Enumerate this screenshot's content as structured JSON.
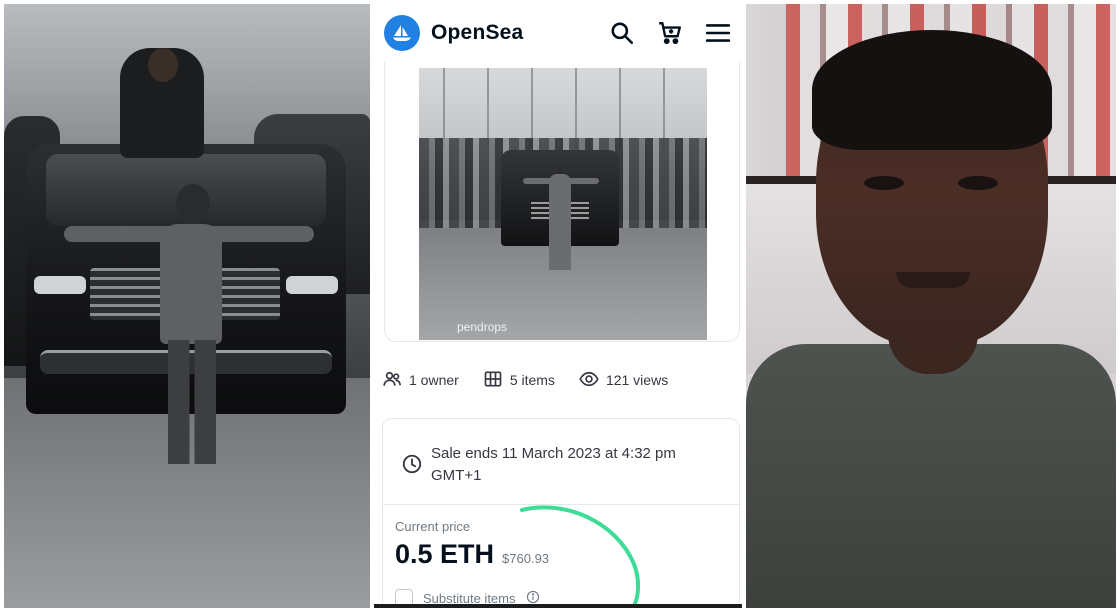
{
  "opensea": {
    "brand": "OpenSea",
    "nft_watermark": "pendrops",
    "stats": {
      "owners": "1 owner",
      "items": "5 items",
      "views": "121 views"
    },
    "sale": {
      "ends_text": "Sale ends 11 March 2023 at 4:32 pm GMT+1",
      "current_price_label": "Current price",
      "price_eth": "0.5 ETH",
      "price_usd": "$760.93",
      "substitute_label": "Substitute items"
    }
  },
  "icons": {
    "logo": "opensea-boat-icon",
    "search": "search-icon",
    "cart": "cart-icon",
    "menu": "hamburger-menu-icon",
    "owner": "users-icon",
    "items": "grid-icon",
    "views": "eye-icon",
    "clock": "clock-icon",
    "info": "info-icon"
  },
  "colors": {
    "opensea_blue": "#2081e2",
    "text_primary": "#04111d",
    "text_secondary": "#707a83",
    "annotation_green": "#3ddc97"
  }
}
